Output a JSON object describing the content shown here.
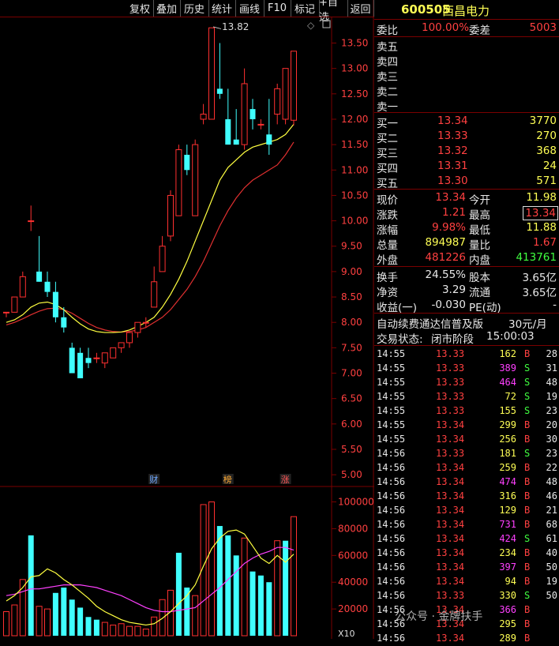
{
  "toolbar": [
    "复权",
    "叠加",
    "历史",
    "统计",
    "画线",
    "F10",
    "标记",
    "+自选",
    "返回"
  ],
  "stock": {
    "code": "600505",
    "name": "西昌电力"
  },
  "weibi": {
    "label1": "委比",
    "value1": "100.00%",
    "label2": "委差",
    "value2": "5003"
  },
  "sell_levels": [
    "卖五",
    "卖四",
    "卖三",
    "卖二",
    "卖一"
  ],
  "buy_levels": [
    {
      "label": "买一",
      "price": "13.34",
      "vol": "3770"
    },
    {
      "label": "买二",
      "price": "13.33",
      "vol": "270"
    },
    {
      "label": "买三",
      "price": "13.32",
      "vol": "368"
    },
    {
      "label": "买四",
      "price": "13.31",
      "vol": "24"
    },
    {
      "label": "买五",
      "price": "13.30",
      "vol": "571"
    }
  ],
  "stats": [
    {
      "l1": "现价",
      "v1": "13.34",
      "l2": "今开",
      "v2": "11.98",
      "c1": "#ff4040",
      "c2": "#ffff55"
    },
    {
      "l1": "涨跌",
      "v1": "1.21",
      "l2": "最高",
      "v2": "13.34",
      "c1": "#ff4040",
      "c2": "#ff4040"
    },
    {
      "l1": "涨幅",
      "v1": "9.98%",
      "l2": "最低",
      "v2": "11.88",
      "c1": "#ff4040",
      "c2": "#ffff55"
    },
    {
      "l1": "总量",
      "v1": "894987",
      "l2": "量比",
      "v2": "1.67",
      "c1": "#ffff55",
      "c2": "#ff4040"
    },
    {
      "l1": "外盘",
      "v1": "481226",
      "l2": "内盘",
      "v2": "413761",
      "c1": "#ff4040",
      "c2": "#40ff40"
    }
  ],
  "stats2": [
    {
      "l1": "换手",
      "v1": "24.55%",
      "l2": "股本",
      "v2": "3.65亿"
    },
    {
      "l1": "净资",
      "v1": "3.29",
      "l2": "流通",
      "v2": "3.65亿"
    },
    {
      "l1": "收益(一)",
      "v1": "-0.030",
      "l2": "PE(动)",
      "v2": "-"
    }
  ],
  "ad": {
    "text": "自动续费通达信普及版",
    "price": "30元/月"
  },
  "trade_status": {
    "label": "交易状态:",
    "value": "闭市阶段",
    "time": "15:00:03"
  },
  "ticks": [
    {
      "t": "14:55",
      "p": "13.33",
      "v": "162",
      "d": "B",
      "n": "28"
    },
    {
      "t": "14:55",
      "p": "13.33",
      "v": "389",
      "d": "S",
      "n": "31"
    },
    {
      "t": "14:55",
      "p": "13.33",
      "v": "464",
      "d": "S",
      "n": "48"
    },
    {
      "t": "14:55",
      "p": "13.33",
      "v": "72",
      "d": "S",
      "n": "19"
    },
    {
      "t": "14:55",
      "p": "13.33",
      "v": "155",
      "d": "S",
      "n": "23"
    },
    {
      "t": "14:55",
      "p": "13.34",
      "v": "299",
      "d": "B",
      "n": "20"
    },
    {
      "t": "14:55",
      "p": "13.34",
      "v": "256",
      "d": "B",
      "n": "30"
    },
    {
      "t": "14:56",
      "p": "13.33",
      "v": "181",
      "d": "S",
      "n": "23"
    },
    {
      "t": "14:56",
      "p": "13.34",
      "v": "259",
      "d": "B",
      "n": "22"
    },
    {
      "t": "14:56",
      "p": "13.34",
      "v": "474",
      "d": "B",
      "n": "48"
    },
    {
      "t": "14:56",
      "p": "13.34",
      "v": "316",
      "d": "B",
      "n": "46"
    },
    {
      "t": "14:56",
      "p": "13.34",
      "v": "129",
      "d": "B",
      "n": "21"
    },
    {
      "t": "14:56",
      "p": "13.34",
      "v": "731",
      "d": "B",
      "n": "68"
    },
    {
      "t": "14:56",
      "p": "13.34",
      "v": "424",
      "d": "S",
      "n": "61"
    },
    {
      "t": "14:56",
      "p": "13.34",
      "v": "234",
      "d": "B",
      "n": "40"
    },
    {
      "t": "14:56",
      "p": "13.34",
      "v": "397",
      "d": "B",
      "n": "50"
    },
    {
      "t": "14:56",
      "p": "13.34",
      "v": "94",
      "d": "B",
      "n": "19"
    },
    {
      "t": "14:56",
      "p": "13.33",
      "v": "330",
      "d": "S",
      "n": "50"
    },
    {
      "t": "14:56",
      "p": "13.34",
      "v": "366",
      "d": "B",
      "n": ""
    },
    {
      "t": "14:56",
      "p": "13.34",
      "v": "295",
      "d": "B",
      "n": ""
    },
    {
      "t": "14:56",
      "p": "13.34",
      "v": "289",
      "d": "B",
      "n": ""
    }
  ],
  "watermark": "公众号 · 金牌扶手",
  "chart_data": {
    "type": "candlestick",
    "price_axis": {
      "min": 4.8,
      "max": 13.85,
      "ticks": [
        "13.50",
        "13.00",
        "12.50",
        "12.00",
        "11.50",
        "11.00",
        "10.50",
        "10.00",
        "9.50",
        "9.00",
        "8.50",
        "8.00",
        "7.50",
        "7.00",
        "6.50",
        "6.00",
        "5.50",
        "5.00"
      ]
    },
    "max_label": "13.82",
    "event_markers": [
      "财",
      "榜",
      "涨"
    ],
    "candles": [
      [
        8.2,
        8.2,
        8.1,
        8.2
      ],
      [
        8.2,
        8.5,
        8.2,
        8.5
      ],
      [
        8.5,
        9.0,
        8.5,
        8.9
      ],
      [
        10.0,
        10.3,
        9.8,
        10.0
      ],
      [
        9.0,
        9.7,
        8.8,
        8.8
      ],
      [
        8.8,
        9.0,
        8.5,
        8.6
      ],
      [
        8.6,
        8.8,
        8.0,
        8.1
      ],
      [
        8.1,
        8.3,
        7.8,
        7.9
      ],
      [
        7.5,
        7.6,
        7.0,
        7.0
      ],
      [
        7.4,
        7.5,
        6.9,
        6.9
      ],
      [
        7.3,
        7.5,
        7.1,
        7.2
      ],
      [
        7.3,
        7.4,
        7.2,
        7.3
      ],
      [
        7.2,
        7.4,
        7.1,
        7.4
      ],
      [
        7.3,
        7.5,
        7.3,
        7.5
      ],
      [
        7.5,
        7.6,
        7.4,
        7.6
      ],
      [
        7.6,
        7.8,
        7.5,
        7.8
      ],
      [
        7.8,
        8.0,
        7.7,
        8.0
      ],
      [
        8.0,
        8.1,
        7.9,
        8.0
      ],
      [
        8.3,
        9.1,
        8.3,
        8.8
      ],
      [
        9.0,
        9.7,
        9.0,
        9.5
      ],
      [
        9.7,
        10.6,
        9.6,
        10.5
      ],
      [
        10.1,
        11.5,
        10.1,
        11.4
      ],
      [
        11.3,
        11.5,
        10.9,
        11.0
      ],
      [
        10.1,
        11.6,
        10.1,
        11.5
      ],
      [
        12.0,
        12.3,
        11.9,
        12.1
      ],
      [
        12.0,
        13.8,
        12.0,
        13.8
      ],
      [
        12.6,
        13.5,
        12.4,
        12.5
      ],
      [
        12.0,
        12.6,
        11.5,
        11.5
      ],
      [
        11.6,
        12.2,
        11.5,
        11.5
      ],
      [
        11.5,
        13.0,
        11.4,
        12.7
      ],
      [
        12.2,
        12.4,
        11.8,
        12.0
      ],
      [
        11.9,
        12.0,
        11.8,
        11.9
      ],
      [
        11.7,
        12.4,
        11.3,
        11.5
      ],
      [
        12.1,
        12.7,
        11.9,
        12.6
      ],
      [
        12.0,
        13.0,
        11.9,
        13.0
      ],
      [
        11.98,
        13.34,
        11.88,
        13.34
      ]
    ],
    "ma_yellow": [
      8.0,
      8.05,
      8.15,
      8.3,
      8.38,
      8.4,
      8.35,
      8.25,
      8.1,
      7.97,
      7.87,
      7.82,
      7.8,
      7.8,
      7.81,
      7.85,
      7.92,
      8.0,
      8.1,
      8.3,
      8.55,
      8.85,
      9.2,
      9.6,
      10.0,
      10.4,
      10.8,
      11.05,
      11.2,
      11.35,
      11.45,
      11.5,
      11.55,
      11.6,
      11.7,
      11.9
    ],
    "ma_red": [
      7.95,
      8.0,
      8.07,
      8.15,
      8.22,
      8.27,
      8.28,
      8.25,
      8.18,
      8.08,
      7.98,
      7.9,
      7.85,
      7.82,
      7.81,
      7.82,
      7.85,
      7.9,
      8.0,
      8.1,
      8.25,
      8.45,
      8.65,
      8.9,
      9.2,
      9.55,
      9.9,
      10.2,
      10.45,
      10.65,
      10.8,
      10.9,
      11.0,
      11.1,
      11.3,
      11.55
    ],
    "volume_axis": {
      "ticks": [
        "100000",
        "80000",
        "60000",
        "40000",
        "20000"
      ],
      "unit": "X10"
    },
    "volumes": [
      {
        "v": 18000,
        "up": true
      },
      {
        "v": 23000,
        "up": true
      },
      {
        "v": 42000,
        "up": true
      },
      {
        "v": 75000,
        "up": false
      },
      {
        "v": 22000,
        "up": true
      },
      {
        "v": 20000,
        "up": true
      },
      {
        "v": 32000,
        "up": false
      },
      {
        "v": 36000,
        "up": false
      },
      {
        "v": 27000,
        "up": false
      },
      {
        "v": 21000,
        "up": false
      },
      {
        "v": 14000,
        "up": false
      },
      {
        "v": 12000,
        "up": false
      },
      {
        "v": 10000,
        "up": true
      },
      {
        "v": 8000,
        "up": true
      },
      {
        "v": 9000,
        "up": true
      },
      {
        "v": 7000,
        "up": true
      },
      {
        "v": 7000,
        "up": true
      },
      {
        "v": 5000,
        "up": true
      },
      {
        "v": 14000,
        "up": true
      },
      {
        "v": 27000,
        "up": true
      },
      {
        "v": 34000,
        "up": true
      },
      {
        "v": 62000,
        "up": false
      },
      {
        "v": 36000,
        "up": false
      },
      {
        "v": 30000,
        "up": true
      },
      {
        "v": 98000,
        "up": true
      },
      {
        "v": 100000,
        "up": true
      },
      {
        "v": 82000,
        "up": false
      },
      {
        "v": 75000,
        "up": false
      },
      {
        "v": 60000,
        "up": false
      },
      {
        "v": 73000,
        "up": true
      },
      {
        "v": 48000,
        "up": false
      },
      {
        "v": 45000,
        "up": false
      },
      {
        "v": 40000,
        "up": false
      },
      {
        "v": 71000,
        "up": true
      },
      {
        "v": 71000,
        "up": false
      },
      {
        "v": 89000,
        "up": true
      }
    ],
    "vol_ma_yellow": [
      26000,
      30000,
      36000,
      44000,
      45000,
      50000,
      47000,
      42000,
      38000,
      33000,
      28000,
      22000,
      18000,
      15000,
      12000,
      10000,
      9000,
      8000,
      9000,
      13000,
      18000,
      24000,
      30000,
      38000,
      52000,
      65000,
      73000,
      78000,
      79000,
      76000,
      67000,
      58000,
      54000,
      60000,
      55000,
      61000
    ],
    "vol_ma_magenta": [
      30000,
      31000,
      33000,
      35000,
      35000,
      36000,
      37000,
      38000,
      38000,
      38000,
      37000,
      36000,
      34000,
      32000,
      30000,
      27000,
      24000,
      21000,
      19000,
      18000,
      18000,
      19000,
      20000,
      21000,
      26000,
      31000,
      36000,
      42000,
      48000,
      54000,
      58000,
      61000,
      63000,
      66000,
      66000,
      64000
    ]
  }
}
